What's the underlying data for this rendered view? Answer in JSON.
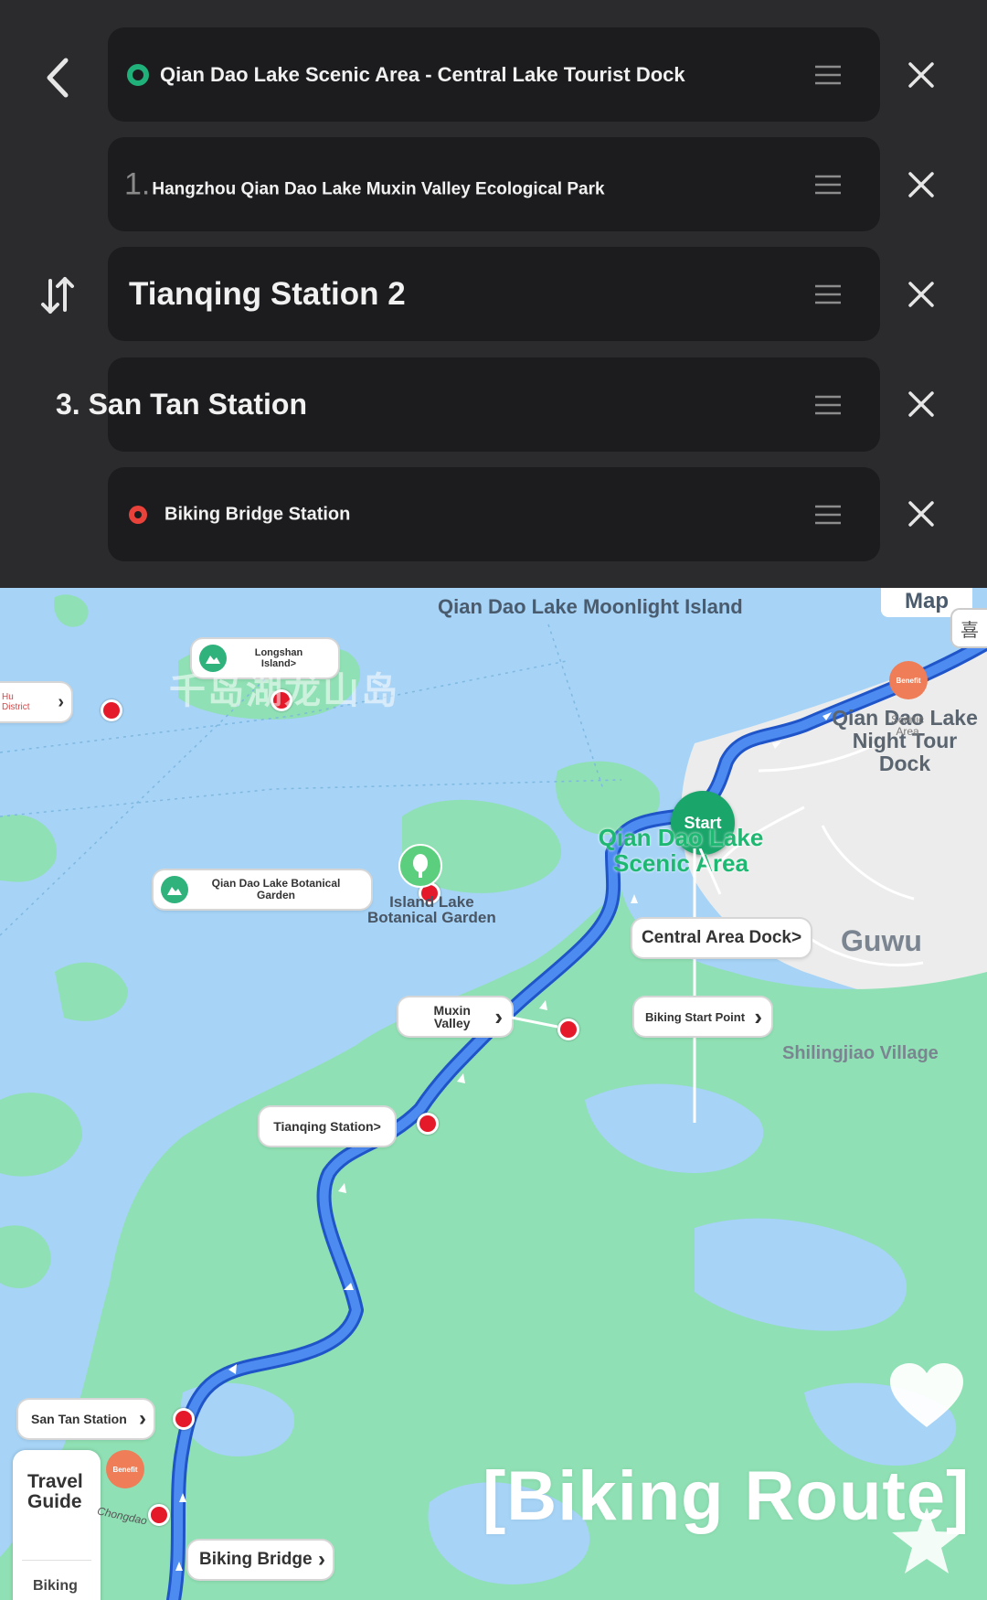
{
  "route_editor": {
    "stops": [
      {
        "label": "Qian Dao Lake Scenic Area - Central Lake Tourist Dock",
        "type": "start"
      },
      {
        "prefix": "1.",
        "label": "Hangzhou Qian Dao Lake Muxin Valley Ecological Park",
        "type": "waypoint"
      },
      {
        "label": "Tianqing Station 2",
        "type": "waypoint"
      },
      {
        "label": "3. San Tan Station",
        "type": "waypoint"
      },
      {
        "label": "Biking Bridge Station",
        "type": "end"
      }
    ],
    "icons": {
      "back": "chevron-left-icon",
      "swap": "swap-icon",
      "drag": "drag-handle-icon",
      "remove": "close-icon"
    },
    "colors": {
      "start_dot": "#20b07a",
      "end_dot": "#e8423b",
      "panel_bg": "#2b2b2d",
      "row_bg": "#1c1c1e"
    }
  },
  "map": {
    "map_button": "Map",
    "map_button_extra": "喜",
    "labels": {
      "moonlight_island": "Qian Dao Lake Moonlight Island",
      "longshan_island": "Longshan\nIsland>",
      "longshan_cn": "千岛湖龙山岛",
      "hu_district": "Hu\nDistrict",
      "night_dock": "Qian Dao Lake\nNight Tour\nDock",
      "night_dock_sub": "Scenic\nArea",
      "start_badge": "Start",
      "scenic_area": "Qian Dao Lake\nScenic Area",
      "botanical_card": "Qian Dao Lake Botanical\nGarden",
      "island_lake": "Island Lake\nBotanical Garden",
      "central_dock": "Central Area Dock>",
      "guwu": "Guwu",
      "muxin": "Muxin\nValley",
      "biking_start": "Biking Start Point",
      "shilingjiao": "Shilingjiao Village",
      "tianqing": "Tianqing Station>",
      "san_tan": "San Tan Station",
      "biking_bridge": "Biking Bridge",
      "chongdao": "Chongdao",
      "benefit": "Benefit",
      "travel_guide": "Travel\nGuide",
      "biking_tab": "Biking",
      "overlay_title": "[Biking Route]"
    },
    "colors": {
      "water": "#a6d3f6",
      "land": "#8fe0b4",
      "urban": "#ececec",
      "route": "#3d7ae8",
      "route_edge": "#1f55c8",
      "pin": "#e4192a",
      "start_green": "#1aa56a"
    }
  }
}
